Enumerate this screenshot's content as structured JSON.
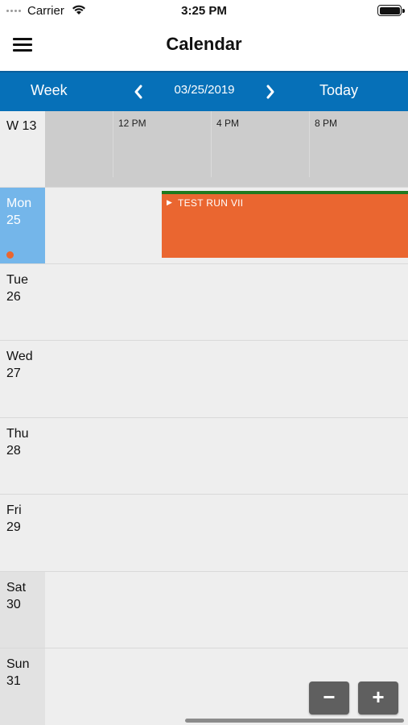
{
  "status_bar": {
    "carrier": "Carrier",
    "time": "3:25 PM",
    "icons": [
      "signal-icon",
      "wifi-icon",
      "battery-icon"
    ]
  },
  "nav": {
    "title": "Calendar",
    "menu_icon": "hamburger-menu-icon"
  },
  "toolbar": {
    "week_label": "Week",
    "date": "03/25/2019",
    "today_label": "Today",
    "prev_icon": "chevron-left-icon",
    "next_icon": "chevron-right-icon",
    "background": "#0670b8"
  },
  "week_header": {
    "label": "W 13",
    "hours": [
      "12 PM",
      "4 PM",
      "8 PM"
    ]
  },
  "days": [
    {
      "name": "Mon",
      "num": "25",
      "today": true
    },
    {
      "name": "Tue",
      "num": "26"
    },
    {
      "name": "Wed",
      "num": "27"
    },
    {
      "name": "Thu",
      "num": "28"
    },
    {
      "name": "Fri",
      "num": "29"
    },
    {
      "name": "Sat",
      "num": "30",
      "weekend": true
    },
    {
      "name": "Sun",
      "num": "31",
      "weekend": true
    }
  ],
  "event": {
    "title": "TEST RUN VII",
    "color": "#ea6630",
    "border_color": "#1f7a1f"
  },
  "zoom": {
    "minus_label": "−",
    "plus_label": "+"
  },
  "colors": {
    "today_bg": "#74b6ea",
    "today_dot": "#ea6630"
  }
}
